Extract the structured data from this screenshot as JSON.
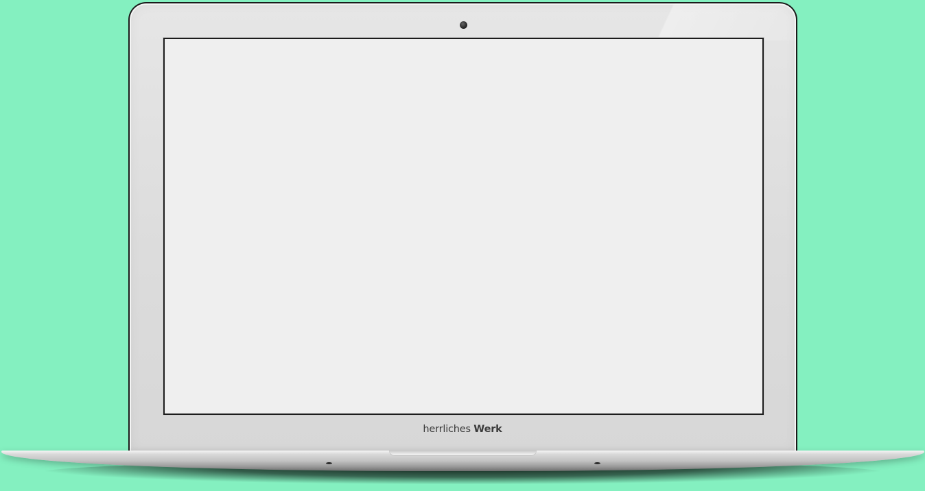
{
  "device": {
    "brand_text_light": "herrliches",
    "brand_text_bold": "Werk"
  },
  "colors": {
    "background": "#84f0c0",
    "screen": "#efefef",
    "bezel": "#dedede",
    "brand_text": "#3b3b3b"
  }
}
